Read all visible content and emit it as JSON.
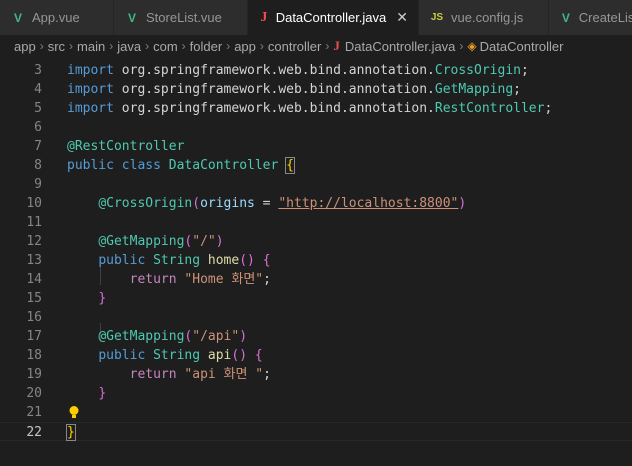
{
  "tabs": [
    {
      "label": "App.vue",
      "icon": "vue-icon",
      "active": false
    },
    {
      "label": "StoreList.vue",
      "icon": "vue-icon",
      "active": false
    },
    {
      "label": "DataController.java",
      "icon": "java-icon",
      "active": true
    },
    {
      "label": "vue.config.js",
      "icon": "js-icon",
      "active": false
    },
    {
      "label": "CreateList",
      "icon": "vue-icon",
      "active": false
    }
  ],
  "breadcrumb": [
    "app",
    "src",
    "main",
    "java",
    "com",
    "folder",
    "app",
    "controller",
    "DataController.java",
    "DataController"
  ],
  "line_numbers": [
    "3",
    "4",
    "5",
    "6",
    "7",
    "8",
    "9",
    "10",
    "11",
    "12",
    "13",
    "14",
    "15",
    "16",
    "17",
    "18",
    "19",
    "20",
    "21",
    "22"
  ],
  "code": {
    "l3": {
      "kw": "import",
      "pkg": "org.springframework.web.bind.annotation.",
      "cls": "CrossOrigin",
      "end": ";"
    },
    "l4": {
      "kw": "import",
      "pkg": "org.springframework.web.bind.annotation.",
      "cls": "GetMapping",
      "end": ";"
    },
    "l5": {
      "kw": "import",
      "pkg": "org.springframework.web.bind.annotation.",
      "cls": "RestController",
      "end": ";"
    },
    "l7": {
      "at": "@",
      "ann": "RestController"
    },
    "l8": {
      "kw1": "public",
      "kw2": "class",
      "name": "DataController",
      "brace": "{"
    },
    "l10": {
      "at": "@",
      "ann": "CrossOrigin",
      "open": "(",
      "param": "origins",
      "eq": " = ",
      "str": "\"http://localhost:8800\"",
      "close": ")"
    },
    "l12": {
      "at": "@",
      "ann": "GetMapping",
      "open": "(",
      "str": "\"/\"",
      "close": ")"
    },
    "l13": {
      "kw": "public",
      "type": "String",
      "fn": "home",
      "parens": "()",
      "brace": "{"
    },
    "l14": {
      "ret": "return",
      "str": "\"Home 화면\"",
      "end": ";"
    },
    "l15": {
      "brace": "}"
    },
    "l17": {
      "at": "@",
      "ann": "GetMapping",
      "open": "(",
      "str": "\"/api\"",
      "close": ")"
    },
    "l18": {
      "kw": "public",
      "type": "String",
      "fn": "api",
      "parens": "()",
      "brace": "{"
    },
    "l19": {
      "ret": "return",
      "str": "\"api 화면 \"",
      "end": ";"
    },
    "l20": {
      "brace": "}"
    },
    "l22": {
      "brace": "}"
    }
  }
}
